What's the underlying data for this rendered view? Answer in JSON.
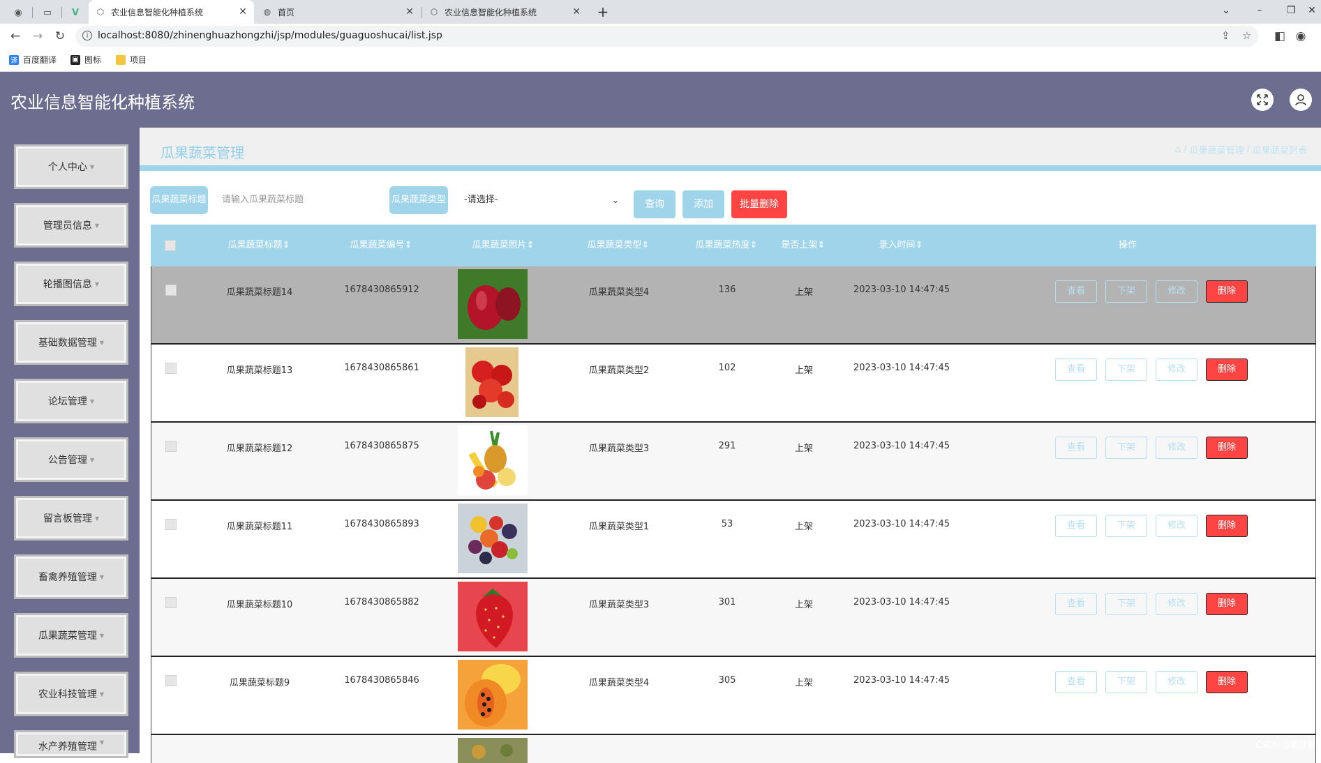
{
  "browser": {
    "tabs": [
      {
        "title": "农业信息智能化种植系统",
        "active": true
      },
      {
        "title": "首页",
        "active": false
      },
      {
        "title": "农业信息智能化种植系统",
        "active": false
      }
    ],
    "url": "localhost:8080/zhinenghuazhongzhi/jsp/modules/guaguoshucai/list.jsp",
    "bookmarks": [
      "百度翻译",
      "图标",
      "项目"
    ]
  },
  "app": {
    "title": "农业信息智能化种植系统"
  },
  "sidebar": {
    "items": [
      "个人中心",
      "管理员信息",
      "轮播图信息",
      "基础数据管理",
      "论坛管理",
      "公告管理",
      "留言板管理",
      "畜禽养殖管理",
      "瓜果蔬菜管理",
      "农业科技管理",
      "水产养殖管理"
    ]
  },
  "page": {
    "title": "瓜果蔬菜管理",
    "breadcrumb": [
      "瓜果蔬菜管理",
      "瓜果蔬菜列表"
    ]
  },
  "search": {
    "title_label": "瓜果蔬菜标题",
    "title_placeholder": "请输入瓜果蔬菜标题",
    "type_label": "瓜果蔬菜类型",
    "type_selected": "-请选择-",
    "query_label": "查询",
    "add_label": "添加",
    "batch_delete_label": "批量删除"
  },
  "table": {
    "columns": [
      "瓜果蔬菜标题",
      "瓜果蔬菜编号",
      "瓜果蔬菜照片",
      "瓜果蔬菜类型",
      "瓜果蔬菜热度",
      "是否上架",
      "录入时间",
      "操作"
    ],
    "rows": [
      {
        "title": "瓜果蔬菜标题14",
        "code": "1678430865912",
        "type": "瓜果蔬菜类型4",
        "heat": "136",
        "status": "上架",
        "time": "2023-03-10 14:47:45"
      },
      {
        "title": "瓜果蔬菜标题13",
        "code": "1678430865861",
        "type": "瓜果蔬菜类型2",
        "heat": "102",
        "status": "上架",
        "time": "2023-03-10 14:47:45"
      },
      {
        "title": "瓜果蔬菜标题12",
        "code": "1678430865875",
        "type": "瓜果蔬菜类型3",
        "heat": "291",
        "status": "上架",
        "time": "2023-03-10 14:47:45"
      },
      {
        "title": "瓜果蔬菜标题11",
        "code": "1678430865893",
        "type": "瓜果蔬菜类型1",
        "heat": "53",
        "status": "上架",
        "time": "2023-03-10 14:47:45"
      },
      {
        "title": "瓜果蔬菜标题10",
        "code": "1678430865882",
        "type": "瓜果蔬菜类型3",
        "heat": "301",
        "status": "上架",
        "time": "2023-03-10 14:47:45"
      },
      {
        "title": "瓜果蔬菜标题9",
        "code": "1678430865846",
        "type": "瓜果蔬菜类型4",
        "heat": "305",
        "status": "上架",
        "time": "2023-03-10 14:47:45"
      }
    ],
    "actions": {
      "view": "查看",
      "off_shelf": "下架",
      "edit": "修改",
      "delete": "删除"
    }
  },
  "watermark": "CSDN @栗豆包"
}
